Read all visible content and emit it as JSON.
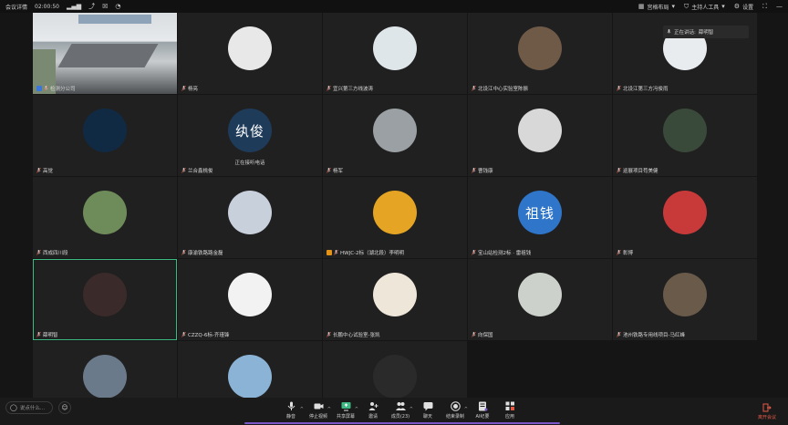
{
  "topbar": {
    "meeting_details": "会议详情",
    "timer": "02:00:50",
    "layout_label": "宫格布局",
    "host_tools_label": "主持人工具",
    "settings_label": "设置"
  },
  "speaking": {
    "prefix": "正在讲话:",
    "name": "薛明智"
  },
  "colors": {
    "active_border": "#3fb983",
    "leave": "#e35b47",
    "accent": "#7a56c9"
  },
  "tiles": [
    {
      "name": "检测分公司",
      "type": "video",
      "host": true
    },
    {
      "name": "杨亮",
      "type": "avatar",
      "bg": "#e8e8e8"
    },
    {
      "name": "宜兴第三方线波涛",
      "type": "avatar",
      "bg": "#dfe6ea"
    },
    {
      "name": "北设江中心实验室陈振",
      "type": "avatar",
      "bg": "#6f5a48"
    },
    {
      "name": "北设江第三方冯俊雨",
      "type": "avatar",
      "bg": "#e9ecef"
    },
    {
      "name": "高觉",
      "type": "avatar",
      "bg": "#112a44"
    },
    {
      "name": "兰合鑫桃俊",
      "type": "text",
      "text": "纨俊",
      "bg": "#1f3b5a",
      "status": "正在接听电话"
    },
    {
      "name": "杨军",
      "type": "avatar",
      "bg": "#9aa0a3"
    },
    {
      "name": "曹钱康",
      "type": "avatar",
      "bg": "#d8d8d8"
    },
    {
      "name": "巡展项目苟美健",
      "type": "avatar",
      "bg": "#3a4a3a"
    },
    {
      "name": "西成四川段",
      "type": "avatar",
      "bg": "#6e8b5a"
    },
    {
      "name": "康渝铁路路金磊",
      "type": "avatar",
      "bg": "#c8d0dc"
    },
    {
      "name": "HWJC-2标（湖北段）李明明",
      "type": "avatar",
      "bg": "#e5a423",
      "co_host": true
    },
    {
      "name": "宝山站检测2标 · 雷祖钱",
      "type": "text",
      "text": "祖钱",
      "bg": "#2f75c9"
    },
    {
      "name": "彰博",
      "type": "avatar",
      "bg": "#c83a3a"
    },
    {
      "name": "薛明智",
      "type": "avatar",
      "bg": "#3b2a2a",
      "active": true
    },
    {
      "name": "CZZQ-6标-齐瑾锋",
      "type": "avatar",
      "bg": "#f2f2f2"
    },
    {
      "name": "长鹏中心试验室-张凯",
      "type": "avatar",
      "bg": "#efe6da"
    },
    {
      "name": "向保国",
      "type": "avatar",
      "bg": "#cdd1cc"
    },
    {
      "name": "池州铁路专用线项目-马红峰",
      "type": "avatar",
      "bg": "#6a5a4a"
    },
    {
      "name": "",
      "type": "avatar",
      "bg": "#6a7a8a"
    },
    {
      "name": "",
      "type": "avatar",
      "bg": "#8bb3d6"
    },
    {
      "name": "",
      "type": "avatar",
      "bg": "#2a2a2a"
    }
  ],
  "bottom": {
    "chat_placeholder": "说点什么...",
    "tools": [
      {
        "label": "静音",
        "icon": "mic-icon",
        "caret": true
      },
      {
        "label": "停止视频",
        "icon": "camera-icon",
        "caret": true
      },
      {
        "label": "共享屏幕",
        "icon": "share-screen-icon",
        "caret": true
      },
      {
        "label": "邀请",
        "icon": "invite-icon"
      },
      {
        "label": "成员(23)",
        "icon": "members-icon",
        "caret": true
      },
      {
        "label": "聊天",
        "icon": "chat-icon"
      },
      {
        "label": "结束录制",
        "icon": "record-icon",
        "caret": true
      },
      {
        "label": "AI纪要",
        "icon": "ai-notes-icon"
      },
      {
        "label": "应用",
        "icon": "apps-icon"
      }
    ],
    "leave_label": "离开会议"
  }
}
